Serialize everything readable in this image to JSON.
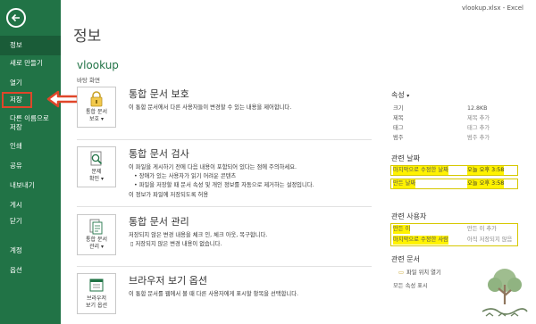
{
  "window": {
    "filename": "vlookup.xlsx - Excel"
  },
  "sidebar": {
    "items": [
      {
        "label": "정보"
      },
      {
        "label": "새로 만들기"
      },
      {
        "label": "열기"
      },
      {
        "label": "저장"
      },
      {
        "label": "다른 이름으로"
      },
      {
        "label": "저장"
      },
      {
        "label": "인쇄"
      },
      {
        "label": "공유"
      },
      {
        "label": "내보내기"
      },
      {
        "label": "게시"
      },
      {
        "label": "닫기"
      },
      {
        "label": "계정"
      },
      {
        "label": "옵션"
      }
    ]
  },
  "main": {
    "title": "정보",
    "workbook_name": "vlookup",
    "workbook_path": "바탕 화면",
    "sections": [
      {
        "title": "통합 문서 보호",
        "desc": "이 통합 문서에서 다른 사용자들이 변경할 수 있는 내용을 제어합니다.",
        "tile_label_1": "통합 문서",
        "tile_label_2": "보호",
        "tile_caret": "▾"
      },
      {
        "title": "통합 문서 검사",
        "desc": "이 파일을 게시하기 전에 다음 내용이 포함되어 있다는 점에 주의하세요.",
        "bullets": [
          "장애가 있는 사용자가 읽기 어려운 콘텐츠",
          "파일을 저장할 때 문서 속성 및 개인 정보를 자동으로 제거하는 설정입니다."
        ],
        "extra": "이 정보가 파일에 저장되도록 허용",
        "tile_label_1": "문제",
        "tile_label_2": "확인",
        "tile_caret": "▾"
      },
      {
        "title": "통합 문서 관리",
        "desc": "저장되지 않은 변경 내용을 체크 인, 체크 아웃, 복구합니다.",
        "bullets": [
          "저장되지 않은 변경 내용이 없습니다."
        ],
        "tile_label_1": "통합 문서",
        "tile_label_2": "관리",
        "tile_caret": "▾"
      },
      {
        "title": "브라우저 보기 옵션",
        "desc": "이 통합 문서를 웹에서 볼 때 다른 사용자에게 표시할 항목을 선택합니다.",
        "tile_label_1": "브라우저",
        "tile_label_2": "보기 옵션"
      }
    ]
  },
  "properties": {
    "heading": "속성",
    "heading_caret": "▾",
    "rows": [
      {
        "key": "크기",
        "value": "12.8KB"
      },
      {
        "key": "제목",
        "value": "제목 추가"
      },
      {
        "key": "태그",
        "value": "태그 추가"
      },
      {
        "key": "범주",
        "value": "범주 추가"
      }
    ],
    "dates_heading": "관련 날짜",
    "dates": [
      {
        "key": "마지막으로 수정한 날짜",
        "value": "오늘 오후 3:58"
      },
      {
        "key": "만든 날짜",
        "value": "오늘 오후 3:58"
      }
    ],
    "people_heading": "관련 사용자",
    "people": [
      {
        "key": "만든 이",
        "value": "만든 이 추가"
      },
      {
        "key": "마지막으로 수정한 사람",
        "value": "아직 저장되지 않음"
      }
    ],
    "docs_heading": "관련 문서",
    "open_location": "파일 위치 열기",
    "show_less": "모든 속성 표시"
  },
  "colors": {
    "sidebar": "#217346",
    "accent": "#217346",
    "highlight": "#fff200",
    "arrow": "#e0462a"
  }
}
